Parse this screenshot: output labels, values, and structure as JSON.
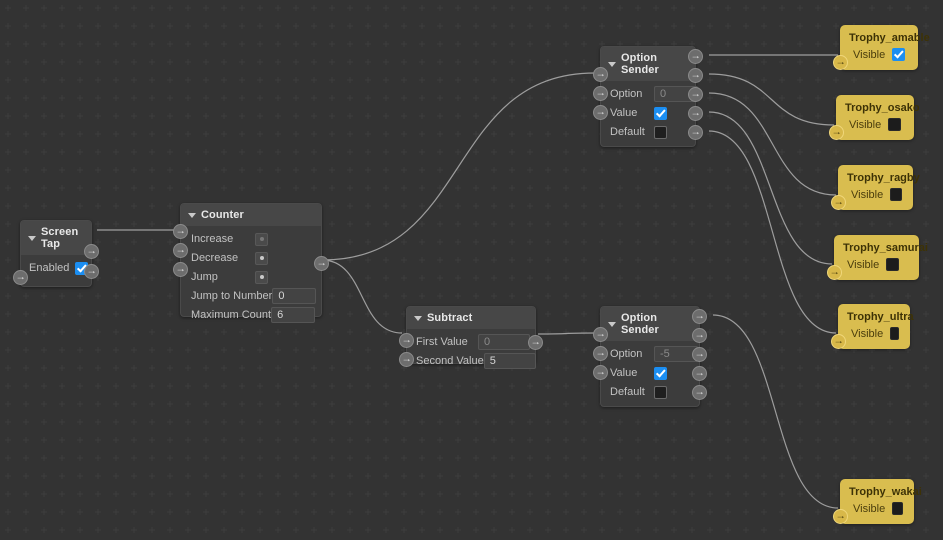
{
  "canvas": {
    "background_color": "#333333",
    "grid_color": "#3d3d3d",
    "wire_color": "#b8b8b8",
    "accent_checkbox_color": "#1b8ef2",
    "gold_node_color": "#d9bd4f"
  },
  "nodes": {
    "screen_tap": {
      "title": "Screen Tap",
      "rows": [
        {
          "label": "Enabled",
          "control": "checkbox",
          "value": true
        }
      ]
    },
    "counter": {
      "title": "Counter",
      "rows": [
        {
          "label": "Increase",
          "control": "pulse"
        },
        {
          "label": "Decrease",
          "control": "pulse"
        },
        {
          "label": "Jump",
          "control": "pulse"
        },
        {
          "label": "Jump to Number",
          "control": "text",
          "value": "0"
        },
        {
          "label": "Maximum Count",
          "control": "text",
          "value": "6"
        }
      ]
    },
    "subtract": {
      "title": "Subtract",
      "rows": [
        {
          "label": "First Value",
          "control": "text",
          "value": "0",
          "dim": true
        },
        {
          "label": "Second Value",
          "control": "text",
          "value": "5",
          "dim": false
        }
      ]
    },
    "option_sender_top": {
      "title": "Option Sender",
      "rows": [
        {
          "label": "Option",
          "control": "text",
          "value": "0",
          "dim": true
        },
        {
          "label": "Value",
          "control": "checkbox",
          "value": true
        },
        {
          "label": "Default",
          "control": "checkbox",
          "value": false
        }
      ],
      "output_count": 5
    },
    "option_sender_bottom": {
      "title": "Option Sender",
      "rows": [
        {
          "label": "Option",
          "control": "text",
          "value": "-5",
          "dim": true
        },
        {
          "label": "Value",
          "control": "checkbox",
          "value": true
        },
        {
          "label": "Default",
          "control": "checkbox",
          "value": false
        }
      ],
      "output_count": 5
    }
  },
  "trophies": [
    {
      "title": "Trophy_amable",
      "row_label": "Visible",
      "visible": true
    },
    {
      "title": "Trophy_osako",
      "row_label": "Visible",
      "visible": false
    },
    {
      "title": "Trophy_ragby",
      "row_label": "Visible",
      "visible": false
    },
    {
      "title": "Trophy_samurai",
      "row_label": "Visible",
      "visible": false
    },
    {
      "title": "Trophy_ultra",
      "row_label": "Visible",
      "visible": false
    },
    {
      "title": "Trophy_wakai",
      "row_label": "Visible",
      "visible": false
    }
  ],
  "icons": {
    "port_arrow": "→",
    "collapse_caret": "caret-down-icon"
  }
}
